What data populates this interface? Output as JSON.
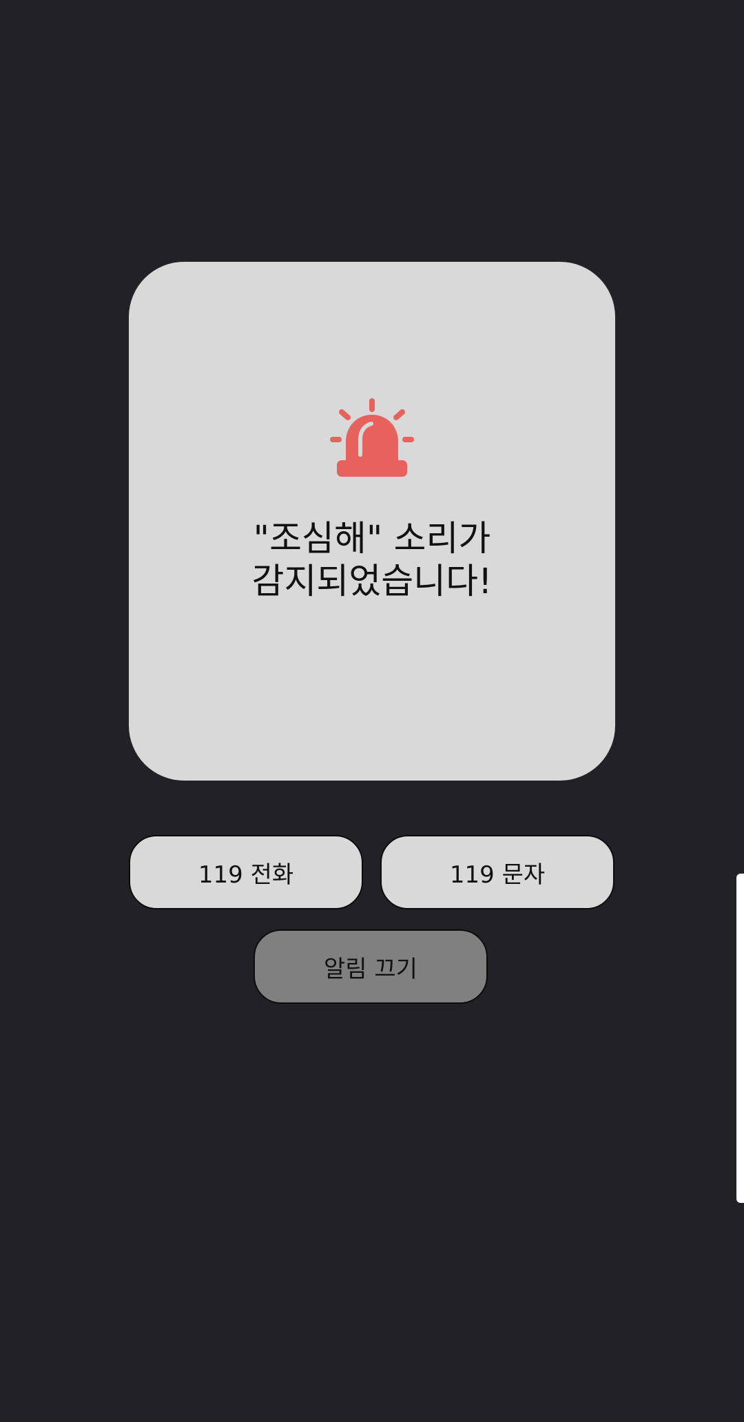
{
  "alert": {
    "icon": "siren-icon",
    "icon_color": "#e8625d",
    "message_line1": "\"조심해\" 소리가",
    "message_line2": "감지되었습니다!"
  },
  "actions": {
    "call_label": "119 전화",
    "sms_label": "119 문자",
    "dismiss_label": "알림 끄기"
  },
  "colors": {
    "background": "#222127",
    "card": "#d9d9d9",
    "dismiss_button": "#808080"
  }
}
